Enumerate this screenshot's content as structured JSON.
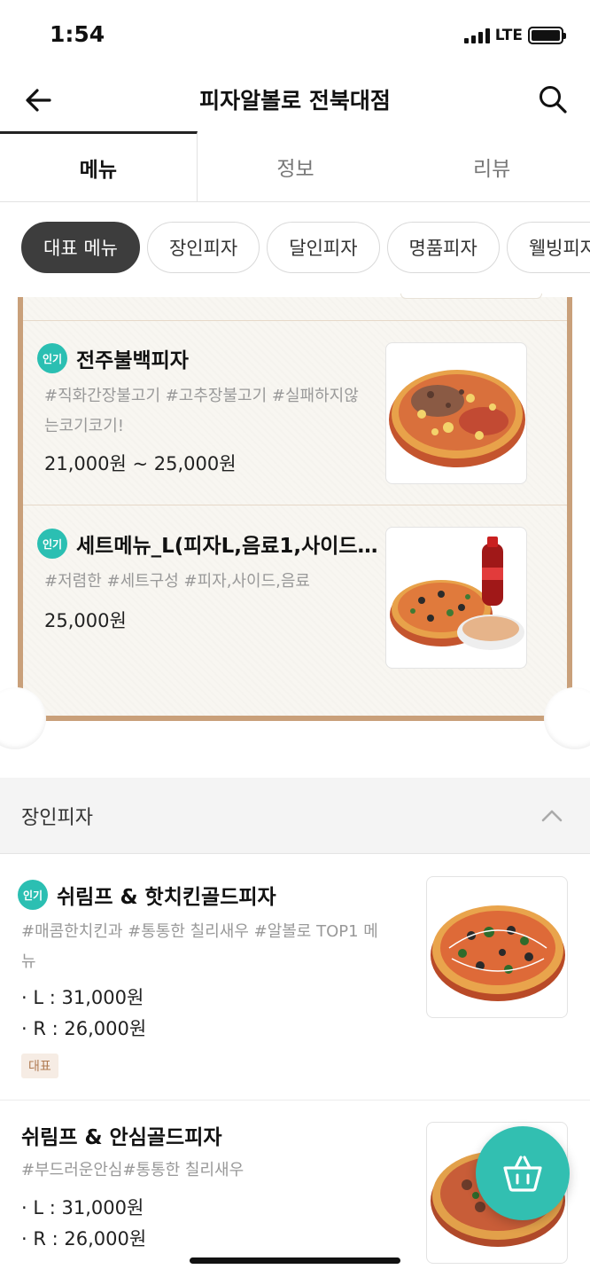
{
  "status": {
    "time": "1:54",
    "network": "LTE"
  },
  "header": {
    "title": "피자알볼로 전북대점"
  },
  "tabs": [
    {
      "label": "메뉴"
    },
    {
      "label": "정보"
    },
    {
      "label": "리뷰"
    }
  ],
  "chips": [
    {
      "label": "대표 메뉴"
    },
    {
      "label": "장인피자"
    },
    {
      "label": "달인피자"
    },
    {
      "label": "명품피자"
    },
    {
      "label": "웰빙피자"
    }
  ],
  "featured": [
    {
      "badge": "인기",
      "name": "전주불백피자",
      "desc_line1": "#직화간장불고기 #고추장불고기 #실패하지않",
      "desc_line2": "는코기코기!",
      "price": "21,000원 ~ 25,000원"
    },
    {
      "badge": "인기",
      "name": "세트메뉴_L(피자L,음료1,사이드…",
      "desc_line1": "#저렴한 #세트구성 #피자,사이드,음료",
      "price": "25,000원"
    }
  ],
  "section": {
    "title": "장인피자"
  },
  "items": [
    {
      "badge": "인기",
      "name": "쉬림프 & 핫치킨골드피자",
      "desc_line1": "#매콤한치킨과 #통통한 칠리새우 #알볼로 TOP1 메",
      "desc_line2": "뉴",
      "price_l": "· L : 31,000원",
      "price_r": "· R : 26,000원",
      "tag": "대표"
    },
    {
      "name": "쉬림프 & 안심골드피자",
      "desc_line1": "#부드러운안심#통통한 칠리새우",
      "price_l": "· L : 31,000원",
      "price_r": "· R : 26,000원"
    }
  ],
  "colors": {
    "accent": "#32bfb1",
    "board_border": "#c9a07a",
    "chip_active": "#3d3d3d"
  },
  "icons": {
    "back": "arrow-left-icon",
    "search": "search-icon",
    "collapse": "chevron-up-icon",
    "cart": "basket-icon"
  }
}
